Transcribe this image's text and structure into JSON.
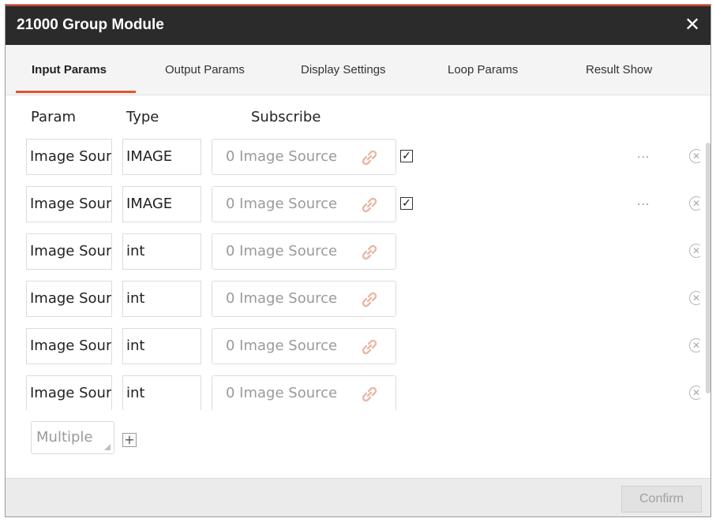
{
  "window": {
    "title": "21000 Group Module",
    "close_icon": "close-icon"
  },
  "tabs": [
    {
      "label": "Input Params",
      "active": true
    },
    {
      "label": "Output Params",
      "active": false
    },
    {
      "label": "Display Settings",
      "active": false
    },
    {
      "label": "Loop Params",
      "active": false
    },
    {
      "label": "Result Show",
      "active": false
    }
  ],
  "columns": {
    "param": "Param",
    "type": "Type",
    "subscribe": "Subscribe"
  },
  "rows": [
    {
      "param": "Image Source",
      "type": "IMAGE",
      "subscribe": "0 Image Source",
      "checked": true,
      "checkbox_glyph": "✓",
      "more": "..."
    },
    {
      "param": "Image Source",
      "type": "IMAGE",
      "subscribe": "0 Image Source",
      "checked": true,
      "checkbox_glyph": "✓",
      "more": "..."
    },
    {
      "param": "Image Source",
      "type": "int",
      "subscribe": "0 Image Source"
    },
    {
      "param": "Image Source",
      "type": "int",
      "subscribe": "0 Image Source"
    },
    {
      "param": "Image Source",
      "type": "int",
      "subscribe": "0 Image Source"
    },
    {
      "param": "Image Source",
      "type": "int",
      "subscribe": "0 Image Source"
    }
  ],
  "add_row": {
    "type_value": "Multiple",
    "add_symbol": "+"
  },
  "footer": {
    "confirm_label": "Confirm"
  },
  "colors": {
    "titlebar": "#2b2b2b",
    "accent": "#e0552f",
    "link_icon": "#e8b8a4"
  }
}
